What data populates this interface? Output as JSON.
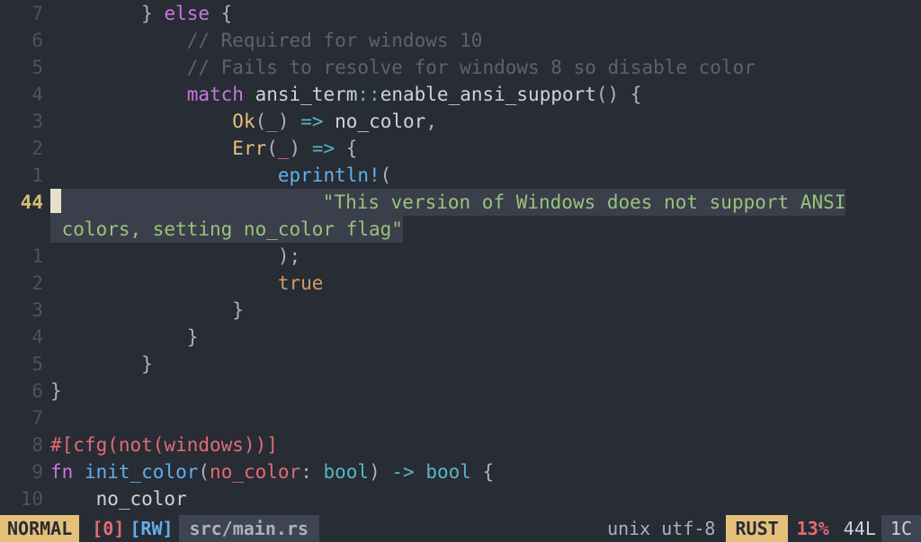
{
  "editor": {
    "lines": [
      {
        "num": "7",
        "current": false,
        "tokens": [
          {
            "cls": "punc",
            "t": "        } "
          },
          {
            "cls": "kw",
            "t": "else"
          },
          {
            "cls": "punc",
            "t": " {"
          }
        ]
      },
      {
        "num": "6",
        "current": false,
        "tokens": [
          {
            "cls": "punc",
            "t": "            "
          },
          {
            "cls": "cmt",
            "t": "// Required for windows 10"
          }
        ]
      },
      {
        "num": "5",
        "current": false,
        "tokens": [
          {
            "cls": "punc",
            "t": "            "
          },
          {
            "cls": "cmt",
            "t": "// Fails to resolve for windows 8 so disable color"
          }
        ]
      },
      {
        "num": "4",
        "current": false,
        "tokens": [
          {
            "cls": "punc",
            "t": "            "
          },
          {
            "cls": "kw",
            "t": "match"
          },
          {
            "cls": "punc",
            "t": " "
          },
          {
            "cls": "fg",
            "t": "ansi_term"
          },
          {
            "cls": "op",
            "t": "::"
          },
          {
            "cls": "fg",
            "t": "enable_ansi_support"
          },
          {
            "cls": "punc",
            "t": "() {"
          }
        ]
      },
      {
        "num": "3",
        "current": false,
        "tokens": [
          {
            "cls": "punc",
            "t": "                "
          },
          {
            "cls": "ty",
            "t": "Ok"
          },
          {
            "cls": "punc",
            "t": "("
          },
          {
            "cls": "ident",
            "t": "_"
          },
          {
            "cls": "punc",
            "t": ") "
          },
          {
            "cls": "op",
            "t": "=>"
          },
          {
            "cls": "punc",
            "t": " "
          },
          {
            "cls": "fg",
            "t": "no_color"
          },
          {
            "cls": "punc",
            "t": ","
          }
        ]
      },
      {
        "num": "2",
        "current": false,
        "tokens": [
          {
            "cls": "punc",
            "t": "                "
          },
          {
            "cls": "ty",
            "t": "Err"
          },
          {
            "cls": "punc",
            "t": "("
          },
          {
            "cls": "ident",
            "t": "_"
          },
          {
            "cls": "punc",
            "t": ") "
          },
          {
            "cls": "op",
            "t": "=>"
          },
          {
            "cls": "punc",
            "t": " {"
          }
        ]
      },
      {
        "num": "1",
        "current": false,
        "tokens": [
          {
            "cls": "punc",
            "t": "                    "
          },
          {
            "cls": "fnname",
            "t": "eprintln!"
          },
          {
            "cls": "punc",
            "t": "("
          }
        ]
      },
      {
        "num": "44",
        "current": true,
        "cursor": true,
        "tokens": [
          {
            "cls": "punc",
            "t": "                       "
          },
          {
            "cls": "str",
            "t": "\"This version of Windows does not support ANSI"
          }
        ],
        "wrap": [
          {
            "cls": "str",
            "t": " colors, setting no_color flag\""
          }
        ]
      },
      {
        "num": "1",
        "current": false,
        "tokens": [
          {
            "cls": "punc",
            "t": "                    );"
          }
        ]
      },
      {
        "num": "2",
        "current": false,
        "tokens": [
          {
            "cls": "punc",
            "t": "                    "
          },
          {
            "cls": "bool",
            "t": "true"
          }
        ]
      },
      {
        "num": "3",
        "current": false,
        "tokens": [
          {
            "cls": "punc",
            "t": "                }"
          }
        ]
      },
      {
        "num": "4",
        "current": false,
        "tokens": [
          {
            "cls": "punc",
            "t": "            }"
          }
        ]
      },
      {
        "num": "5",
        "current": false,
        "tokens": [
          {
            "cls": "punc",
            "t": "        }"
          }
        ]
      },
      {
        "num": "6",
        "current": false,
        "tokens": [
          {
            "cls": "punc",
            "t": "}"
          }
        ]
      },
      {
        "num": "7",
        "current": false,
        "tokens": [
          {
            "cls": "punc",
            "t": ""
          }
        ]
      },
      {
        "num": "8",
        "current": false,
        "tokens": [
          {
            "cls": "attr",
            "t": "#[cfg(not(windows))]"
          }
        ]
      },
      {
        "num": "9",
        "current": false,
        "tokens": [
          {
            "cls": "kw",
            "t": "fn"
          },
          {
            "cls": "punc",
            "t": " "
          },
          {
            "cls": "fnname",
            "t": "init_color"
          },
          {
            "cls": "punc",
            "t": "("
          },
          {
            "cls": "ident",
            "t": "no_color"
          },
          {
            "cls": "punc",
            "t": ": "
          },
          {
            "cls": "typename",
            "t": "bool"
          },
          {
            "cls": "punc",
            "t": ") "
          },
          {
            "cls": "op",
            "t": "->"
          },
          {
            "cls": "punc",
            "t": " "
          },
          {
            "cls": "typename",
            "t": "bool"
          },
          {
            "cls": "punc",
            "t": " {"
          }
        ]
      },
      {
        "num": "10",
        "current": false,
        "tokens": [
          {
            "cls": "punc",
            "t": "    "
          },
          {
            "cls": "fg",
            "t": "no_color"
          }
        ]
      }
    ]
  },
  "statusline": {
    "mode": "NORMAL",
    "modified": "[0]",
    "rw": "[RW]",
    "file": "src/main.rs",
    "encoding": "unix utf-8",
    "filetype": "RUST",
    "percent": "13%",
    "linecount": "44L",
    "col": "1C"
  }
}
